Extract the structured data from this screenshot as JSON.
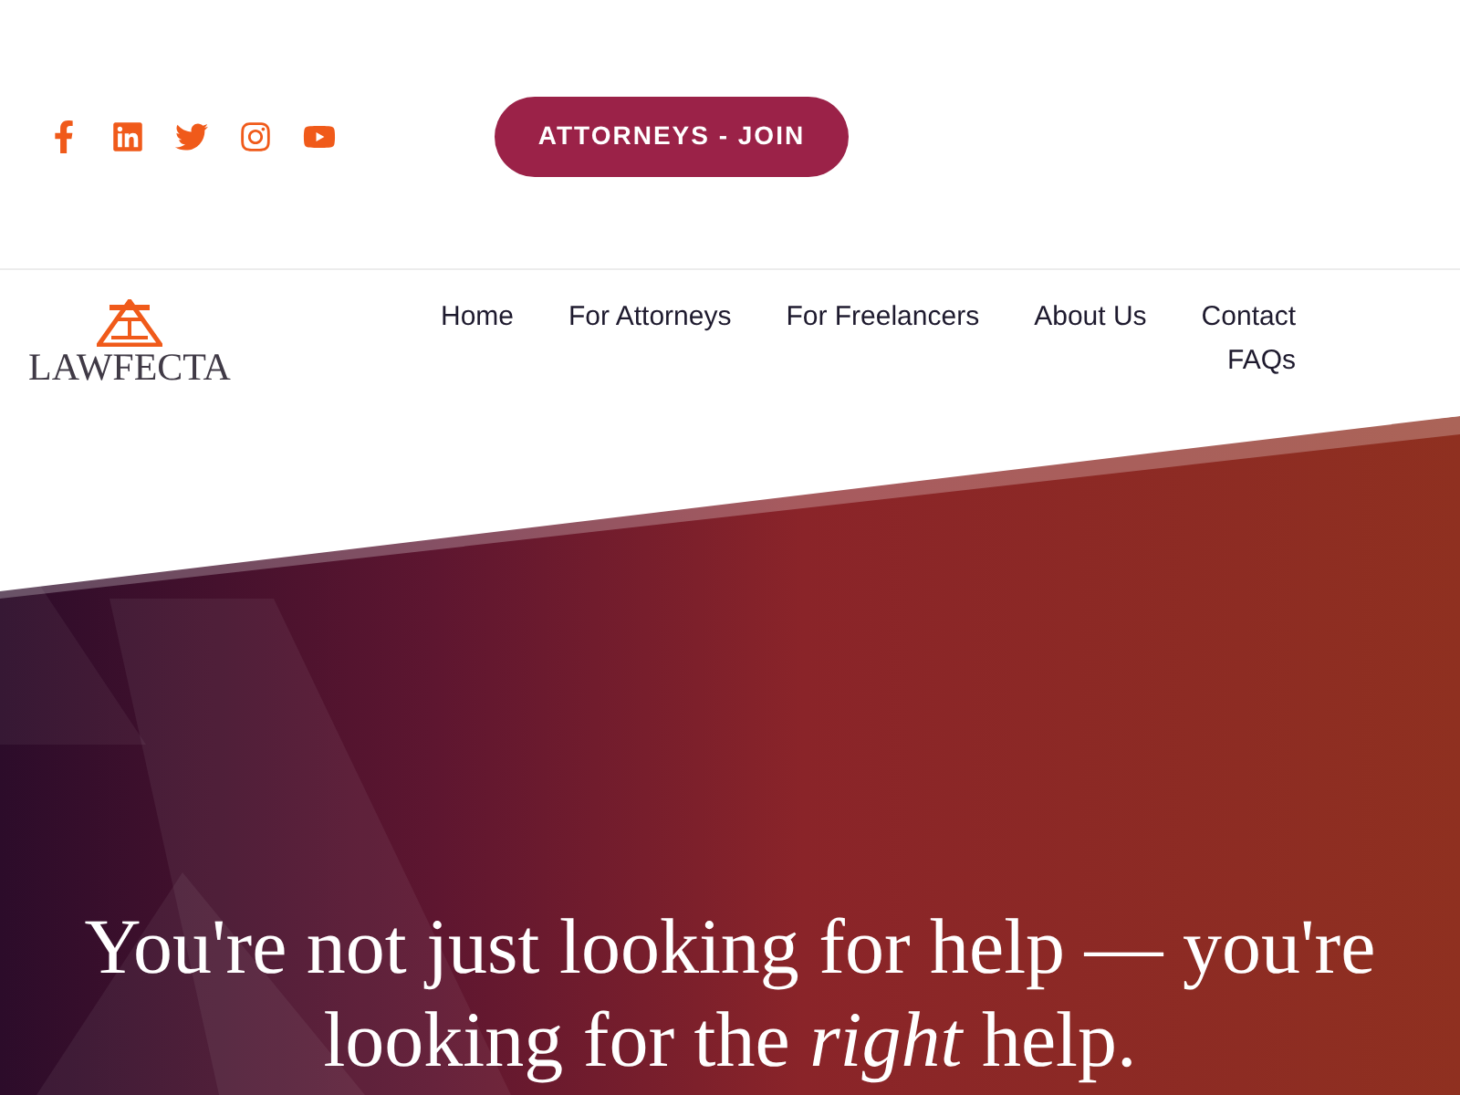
{
  "social_links": [
    {
      "kind": "facebook"
    },
    {
      "kind": "linkedin"
    },
    {
      "kind": "twitter"
    },
    {
      "kind": "instagram"
    },
    {
      "kind": "youtube"
    }
  ],
  "join_button": "ATTORNEYS - JOIN",
  "logo": {
    "text": "LAWFECTA"
  },
  "nav": [
    {
      "label": "Home"
    },
    {
      "label": "For Attorneys"
    },
    {
      "label": "For Freelancers"
    },
    {
      "label": "About Us"
    },
    {
      "label": "Contact"
    },
    {
      "label": "FAQs"
    }
  ],
  "hero": {
    "heading": "You're not just looking for help — you're looking for the *right* help."
  }
}
